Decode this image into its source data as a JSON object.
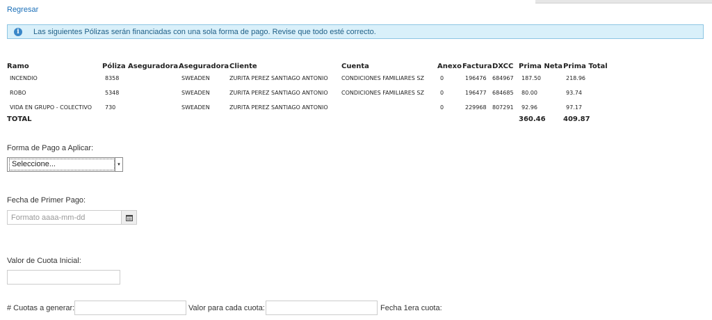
{
  "nav": {
    "back_label": "Regresar"
  },
  "alert": {
    "icon": "info-icon",
    "text": "Las siguientes Pólizas serán financiadas con una sola forma de pago. Revise que todo esté correcto."
  },
  "table": {
    "headers": [
      "Ramo",
      "Póliza",
      "Aseguradora",
      "Aseguradora",
      "Cliente",
      "Cuenta",
      "Anexo",
      "Factura",
      "DXCC",
      "Prima Neta",
      "Prima Total"
    ],
    "rows": [
      [
        "INCENDIO",
        "8358",
        "",
        "SWEADEN",
        "ZURITA PEREZ SANTIAGO ANTONIO",
        "CONDICIONES FAMILIARES SZ",
        "0",
        "196476",
        "684967",
        "187.50",
        "218.96"
      ],
      [
        "ROBO",
        "5348",
        "",
        "SWEADEN",
        "ZURITA PEREZ SANTIAGO ANTONIO",
        "CONDICIONES FAMILIARES SZ",
        "0",
        "196477",
        "684685",
        "80.00",
        "93.74"
      ],
      [
        "VIDA EN GRUPO - COLECTIVO",
        "730",
        "",
        "SWEADEN",
        "ZURITA PEREZ SANTIAGO ANTONIO",
        "",
        "0",
        "229968",
        "807291",
        "92.96",
        "97.17"
      ]
    ],
    "total_label": "TOTAL",
    "total_prima_neta": "360.46",
    "total_prima_total": "409.87"
  },
  "form": {
    "forma_pago_label": "Forma de Pago a Aplicar:",
    "forma_pago_selected": "Seleccione...",
    "fecha_primer_pago_label": "Fecha de Primer Pago:",
    "fecha_primer_pago_placeholder": "Formato aaaa-mm-dd",
    "fecha_primer_pago_value": "",
    "valor_cuota_inicial_label": "Valor de Cuota Inicial:",
    "valor_cuota_inicial_value": "",
    "cuotas_label": "# Cuotas a generar:",
    "cuotas_value": "",
    "valor_cada_cuota_label": "Valor para cada cuota:",
    "valor_cada_cuota_value": "",
    "fecha_1era_cuota_label": "Fecha 1era cuota:"
  },
  "colors": {
    "link": "#1a6fb8",
    "alert_bg": "#d9f0fa",
    "alert_border": "#8cc5e3",
    "alert_text": "#1f5f87"
  }
}
